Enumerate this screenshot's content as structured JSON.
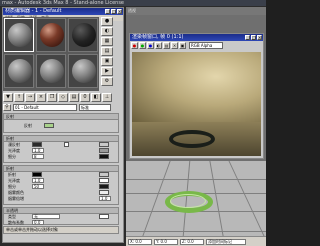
{
  "app": {
    "title": "max - Autodesk 3ds Max 8 - Stand-alone License"
  },
  "material_editor": {
    "title": "材质编辑器 - 1 - Default",
    "menu": [
      "材质",
      "导航",
      "选项",
      "工具"
    ],
    "slots": [
      {
        "label": "slot-1",
        "kind": "gray"
      },
      {
        "label": "slot-2",
        "kind": "wood"
      },
      {
        "label": "slot-3",
        "kind": "dark"
      },
      {
        "label": "slot-4",
        "kind": "gray"
      },
      {
        "label": "slot-5",
        "kind": "gray"
      },
      {
        "label": "slot-6",
        "kind": "gray"
      }
    ],
    "material_name": "01 - Default",
    "material_type": "标准",
    "rollouts": [
      {
        "title": "反射",
        "rows": [
          {
            "label": "反射",
            "value": "",
            "swatch_color": "#a8d28a"
          }
        ]
      },
      {
        "title": "折射",
        "rows": [
          {
            "label": "漫反射",
            "value": "",
            "swatch_color": "#2a2a2a"
          },
          {
            "label": "光泽度",
            "value": "1.0",
            "swatch_color": "#9a9a9a"
          },
          {
            "label": "细分",
            "value": "8",
            "swatch_color": "#111111"
          }
        ]
      },
      {
        "title": "折射",
        "rows": [
          {
            "label": "折射",
            "value": "",
            "swatch_color": "#000000"
          },
          {
            "label": "光泽度",
            "value": "1.0",
            "swatch_color": "#ffffff"
          },
          {
            "label": "细分",
            "value": "50",
            "swatch_color": "#1a1a1a"
          },
          {
            "label": "烟雾颜色",
            "value": "",
            "swatch_color": "#eeeeee"
          },
          {
            "label": "烟雾倍增",
            "value": "1.0",
            "swatch_color": "#ffffff"
          }
        ]
      },
      {
        "title": "半透明",
        "rows": [
          {
            "label": "类型",
            "value": "无",
            "swatch_color": "#ffffff"
          },
          {
            "label": "散布系数",
            "value": "0.0",
            "swatch_color": "#ffffff"
          }
        ]
      }
    ],
    "status_text": "单击或单击并拖动以选择对象"
  },
  "render_window": {
    "title": "渲染帧窗口, 帧 0 (1:1)",
    "channel_select": "RGB Alpha",
    "viewport_label": "透视"
  },
  "status_bar": {
    "fields": [
      "X: 0.0",
      "Y: 0.0",
      "Z: 0.0",
      "添加时间标记"
    ]
  },
  "colors": {
    "title_blue": "#1b2d8a",
    "ring_green": "#79b849",
    "panel_gray": "#c9c9c9"
  }
}
